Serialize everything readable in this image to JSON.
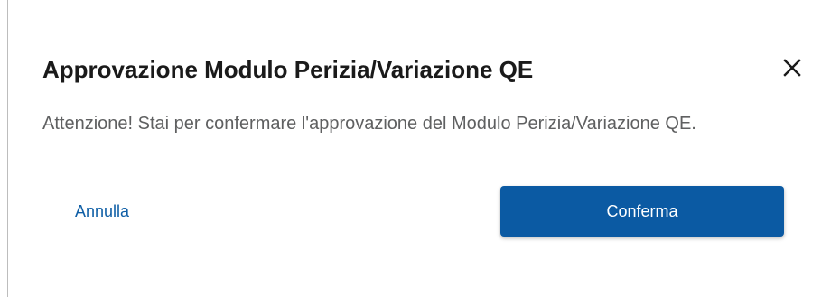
{
  "dialog": {
    "title": "Approvazione Modulo Perizia/Variazione QE",
    "message": "Attenzione! Stai per confermare l'approvazione del Modulo Perizia/Variazione QE.",
    "close_icon": "close-icon",
    "cancel_label": "Annulla",
    "confirm_label": "Conferma"
  },
  "colors": {
    "primary": "#0b5aa3",
    "link": "#0f5fa6",
    "title_text": "#1a1a1a",
    "body_text": "#5f6061"
  }
}
